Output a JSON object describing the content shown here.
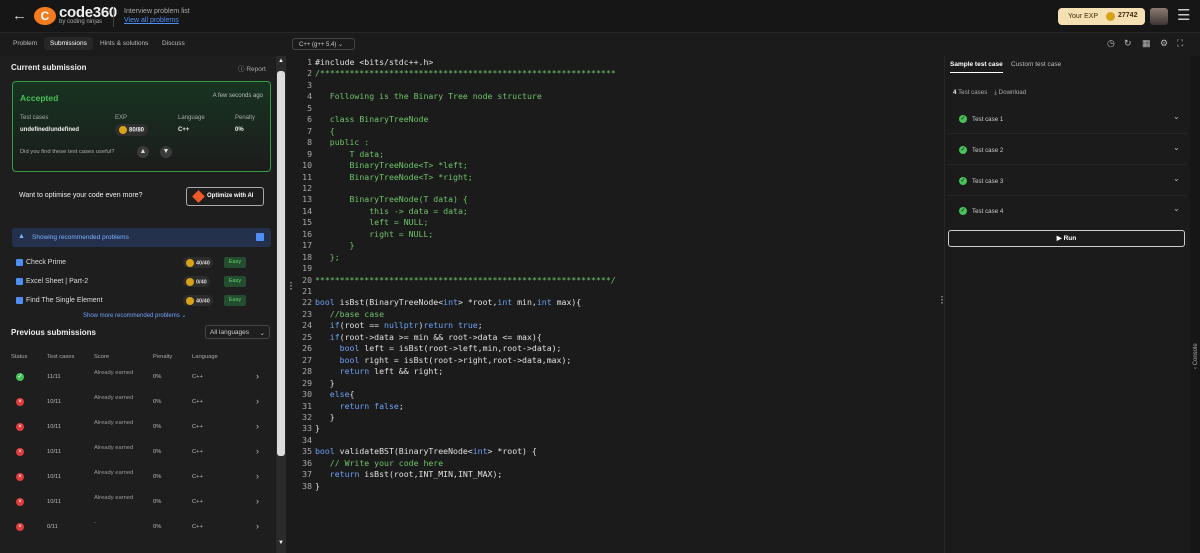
{
  "header": {
    "logo_letter": "C",
    "logo_title": "code360",
    "logo_sub": "by coding ninjas",
    "crumb": "Interview problem list",
    "crumb_link": "View all problems",
    "exp_label": "Your EXP",
    "exp_value": "27742"
  },
  "tabs": [
    "Problem",
    "Submissions",
    "Hints & solutions",
    "Discuss"
  ],
  "language_select": "C++ (g++ 5.4)",
  "submission": {
    "title": "Current submission",
    "report": "Report",
    "status": "Accepted",
    "time": "A few seconds ago",
    "labels": [
      "Test cases",
      "EXP",
      "Language",
      "Penalty"
    ],
    "test_cases": "undefined/undefined",
    "exp": "80/80",
    "language": "C++",
    "penalty": "0%",
    "useful": "Did you find these test cases useful?"
  },
  "optimise": {
    "text": "Want to optimise your code even more?",
    "button": "Optimize with AI"
  },
  "recommended": {
    "bar": "Showing recommended problems",
    "items": [
      {
        "name": "Check Prime",
        "score": "40/40",
        "level": "Easy"
      },
      {
        "name": "Excel Sheet | Part-2",
        "score": "0/40",
        "level": "Easy"
      },
      {
        "name": "Find The Single Element",
        "score": "40/40",
        "level": "Easy"
      }
    ],
    "show_more": "Show more recommended problems"
  },
  "previous": {
    "title": "Previous submissions",
    "filter": "All languages",
    "headers": [
      "Status",
      "Test cases",
      "Score",
      "Penalty",
      "Language"
    ],
    "rows": [
      {
        "status": "pass",
        "tests": "11/11",
        "score": "Already earned",
        "penalty": "0%",
        "lang": "C++"
      },
      {
        "status": "fail",
        "tests": "10/11",
        "score": "Already earned",
        "penalty": "0%",
        "lang": "C++"
      },
      {
        "status": "fail",
        "tests": "10/11",
        "score": "Already earned",
        "penalty": "0%",
        "lang": "C++"
      },
      {
        "status": "fail",
        "tests": "10/11",
        "score": "Already earned",
        "penalty": "0%",
        "lang": "C++"
      },
      {
        "status": "fail",
        "tests": "10/11",
        "score": "Already earned",
        "penalty": "0%",
        "lang": "C++"
      },
      {
        "status": "fail",
        "tests": "10/11",
        "score": "Already earned",
        "penalty": "0%",
        "lang": "C++"
      },
      {
        "status": "fail",
        "tests": "0/11",
        "score": "-",
        "penalty": "0%",
        "lang": "C++"
      }
    ]
  },
  "code_lines": [
    "#include <bits/stdc++.h>",
    "/************************************************************",
    "",
    "   Following is the Binary Tree node structure",
    "",
    "   class BinaryTreeNode",
    "   {",
    "   public :",
    "       T data;",
    "       BinaryTreeNode<T> *left;",
    "       BinaryTreeNode<T> *right;",
    "",
    "       BinaryTreeNode(T data) {",
    "           this -> data = data;",
    "           left = NULL;",
    "           right = NULL;",
    "       }",
    "   };",
    "",
    "************************************************************/",
    "",
    "bool isBst(BinaryTreeNode<int> *root,int min,int max){",
    "   //base case",
    "   if(root == nullptr)return true;",
    "   if(root->data >= min && root->data <= max){",
    "     bool left = isBst(root->left,min,root->data);",
    "     bool right = isBst(root->right,root->data,max);",
    "     return left && right;",
    "   }",
    "   else{",
    "     return false;",
    "   }",
    "}",
    "",
    "bool validateBST(BinaryTreeNode<int> *root) {",
    "   // Write your code here",
    "   return isBst(root,INT_MIN,INT_MAX);",
    "}"
  ],
  "right_panel": {
    "tabs": [
      "Sample test case",
      "Custom test case"
    ],
    "count": "4",
    "count_label": "Test cases",
    "download": "Download",
    "cases": [
      "Test case 1",
      "Test case 2",
      "Test case 3",
      "Test case 4"
    ],
    "run": "Run"
  },
  "console_label": "Console"
}
